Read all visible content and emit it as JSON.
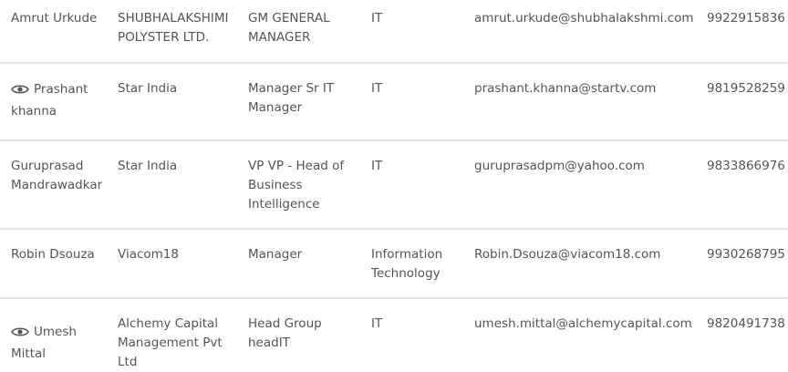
{
  "icons": {
    "view": "eye-icon"
  },
  "rows": [
    {
      "name_line1": "Amrut Urkude",
      "name_line2": "",
      "has_eye": false,
      "org": "SHUBHALAKSHIMI POLYSTER LTD.",
      "title": "GM GENERAL MANAGER",
      "dept": "IT",
      "email": "amrut.urkude@shubhalakshmi.com",
      "phone": "9922915836"
    },
    {
      "name_line1": "Prashant",
      "name_line2": "khanna",
      "has_eye": true,
      "org": "Star India",
      "title": "Manager Sr IT Manager",
      "dept": "IT",
      "email": "prashant.khanna@startv.com",
      "phone": "9819528259"
    },
    {
      "name_line1": "Guruprasad Mandrawadkar",
      "name_line2": "",
      "has_eye": false,
      "org": "Star India",
      "title": "VP VP - Head of Business Intelligence",
      "dept": "IT",
      "email": "guruprasadpm@yahoo.com",
      "phone": "9833866976"
    },
    {
      "name_line1": "Robin Dsouza",
      "name_line2": "",
      "has_eye": false,
      "org": "Viacom18",
      "title": "Manager",
      "dept": "Information Technology",
      "email": "Robin.Dsouza@viacom18.com",
      "phone": "9930268795"
    },
    {
      "name_line1": "Umesh",
      "name_line2": "Mittal",
      "has_eye": true,
      "org": "Alchemy Capital Management Pvt Ltd",
      "title": "Head Group headIT",
      "dept": "IT",
      "email": "umesh.mittal@alchemycapital.com",
      "phone": "9820491738"
    }
  ]
}
